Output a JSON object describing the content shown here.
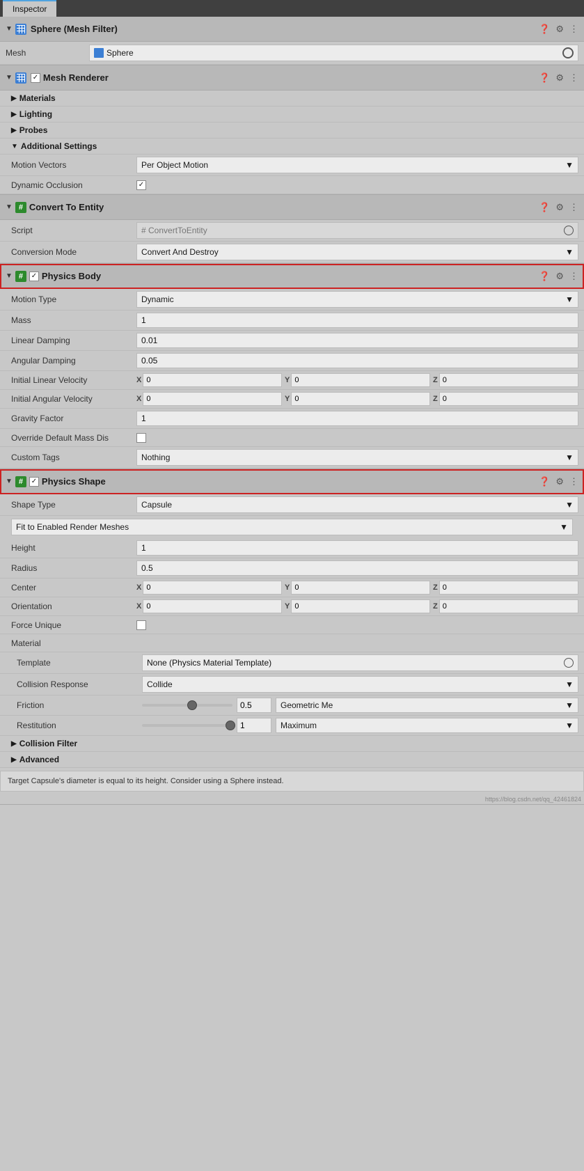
{
  "header": {
    "title": "Inspector",
    "lock_icon": "🔒"
  },
  "mesh_filter": {
    "section_title": "Sphere (Mesh Filter)",
    "mesh_label": "Mesh",
    "mesh_value": "Sphere"
  },
  "mesh_renderer": {
    "section_title": "Mesh Renderer",
    "items": [
      {
        "label": "Materials",
        "collapsed": true
      },
      {
        "label": "Lighting",
        "collapsed": true
      },
      {
        "label": "Probes",
        "collapsed": true
      }
    ],
    "additional_settings": {
      "label": "Additional Settings",
      "motion_vectors_label": "Motion Vectors",
      "motion_vectors_value": "Per Object Motion",
      "dynamic_occlusion_label": "Dynamic Occlusion",
      "dynamic_occlusion_checked": true
    }
  },
  "convert_to_entity": {
    "section_title": "Convert To Entity",
    "script_label": "Script",
    "script_value": "# ConvertToEntity",
    "conversion_mode_label": "Conversion Mode",
    "conversion_mode_value": "Convert And Destroy"
  },
  "physics_body": {
    "section_title": "Physics Body",
    "motion_type_label": "Motion Type",
    "motion_type_value": "Dynamic",
    "mass_label": "Mass",
    "mass_value": "1",
    "linear_damping_label": "Linear Damping",
    "linear_damping_value": "0.01",
    "angular_damping_label": "Angular Damping",
    "angular_damping_value": "0.05",
    "initial_linear_velocity_label": "Initial Linear Velocity",
    "initial_angular_velocity_label": "Initial Angular Velocity",
    "gravity_factor_label": "Gravity Factor",
    "gravity_factor_value": "1",
    "override_mass_label": "Override Default Mass Dis",
    "custom_tags_label": "Custom Tags",
    "custom_tags_value": "Nothing"
  },
  "physics_shape": {
    "section_title": "Physics Shape",
    "shape_type_label": "Shape Type",
    "shape_type_value": "Capsule",
    "fit_label": "Fit to Enabled Render Meshes",
    "height_label": "Height",
    "height_value": "1",
    "radius_label": "Radius",
    "radius_value": "0.5",
    "center_label": "Center",
    "orientation_label": "Orientation",
    "force_unique_label": "Force Unique",
    "material_label": "Material",
    "template_label": "Template",
    "template_value": "None (Physics Material Template)",
    "collision_response_label": "Collision Response",
    "collision_response_value": "Collide",
    "friction_label": "Friction",
    "friction_value": "0.5",
    "friction_type": "Geometric Me",
    "restitution_label": "Restitution",
    "restitution_value": "1",
    "restitution_type": "Maximum",
    "collision_filter_label": "Collision Filter",
    "advanced_label": "Advanced"
  },
  "xyz_zeros": {
    "x": "0",
    "y": "0",
    "z": "0"
  },
  "info_box_text": "Target Capsule's diameter is equal to its height. Consider using a Sphere instead.",
  "watermark": "https://blog.csdn.net/qq_42461824"
}
